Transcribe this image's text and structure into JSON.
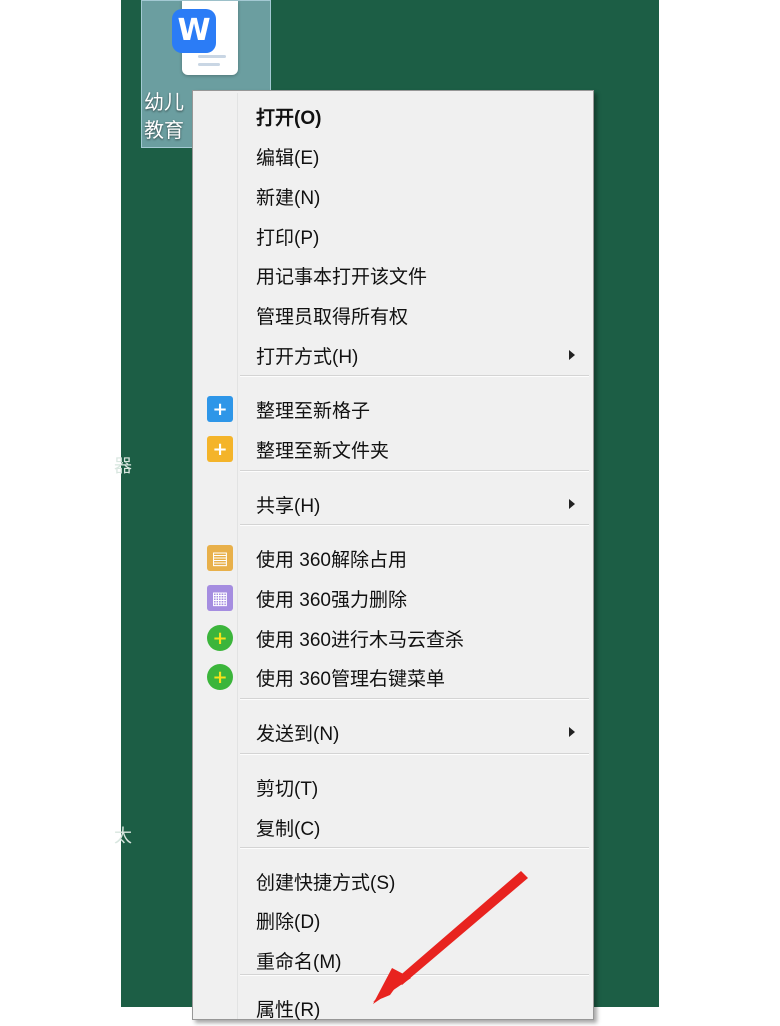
{
  "desktop": {
    "file": {
      "icon": "wps-writer-document-icon",
      "app_letter": "W",
      "label_line1": "幼儿",
      "label_line2": "教育"
    },
    "edge_chars": [
      "器",
      "太"
    ]
  },
  "context_menu": {
    "groups": [
      [
        {
          "label": "打开(O)",
          "bold": true
        },
        {
          "label": "编辑(E)"
        },
        {
          "label": "新建(N)"
        },
        {
          "label": "打印(P)"
        },
        {
          "label": "用记事本打开该文件"
        },
        {
          "label": "管理员取得所有权"
        },
        {
          "label": "打开方式(H)",
          "submenu": true
        }
      ],
      [
        {
          "label": "整理至新格子",
          "icon": "blue-plus-icon"
        },
        {
          "label": "整理至新文件夹",
          "icon": "yellow-folder-plus-icon"
        }
      ],
      [
        {
          "label": "共享(H)",
          "submenu": true
        }
      ],
      [
        {
          "label": "使用 360解除占用",
          "icon": "360-unlock-folder-icon"
        },
        {
          "label": "使用 360强力删除",
          "icon": "360-shredder-icon"
        },
        {
          "label": "使用 360进行木马云查杀",
          "icon": "360-security-icon"
        },
        {
          "label": "使用 360管理右键菜单",
          "icon": "360-security-icon"
        }
      ],
      [
        {
          "label": "发送到(N)",
          "submenu": true
        }
      ],
      [
        {
          "label": "剪切(T)"
        },
        {
          "label": "复制(C)"
        }
      ],
      [
        {
          "label": "创建快捷方式(S)"
        },
        {
          "label": "删除(D)"
        },
        {
          "label": "重命名(M)"
        }
      ],
      [
        {
          "label": "属性(R)"
        }
      ]
    ]
  },
  "annotation": {
    "type": "red-arrow",
    "color": "#e8231f",
    "points_to": "属性(R)"
  }
}
